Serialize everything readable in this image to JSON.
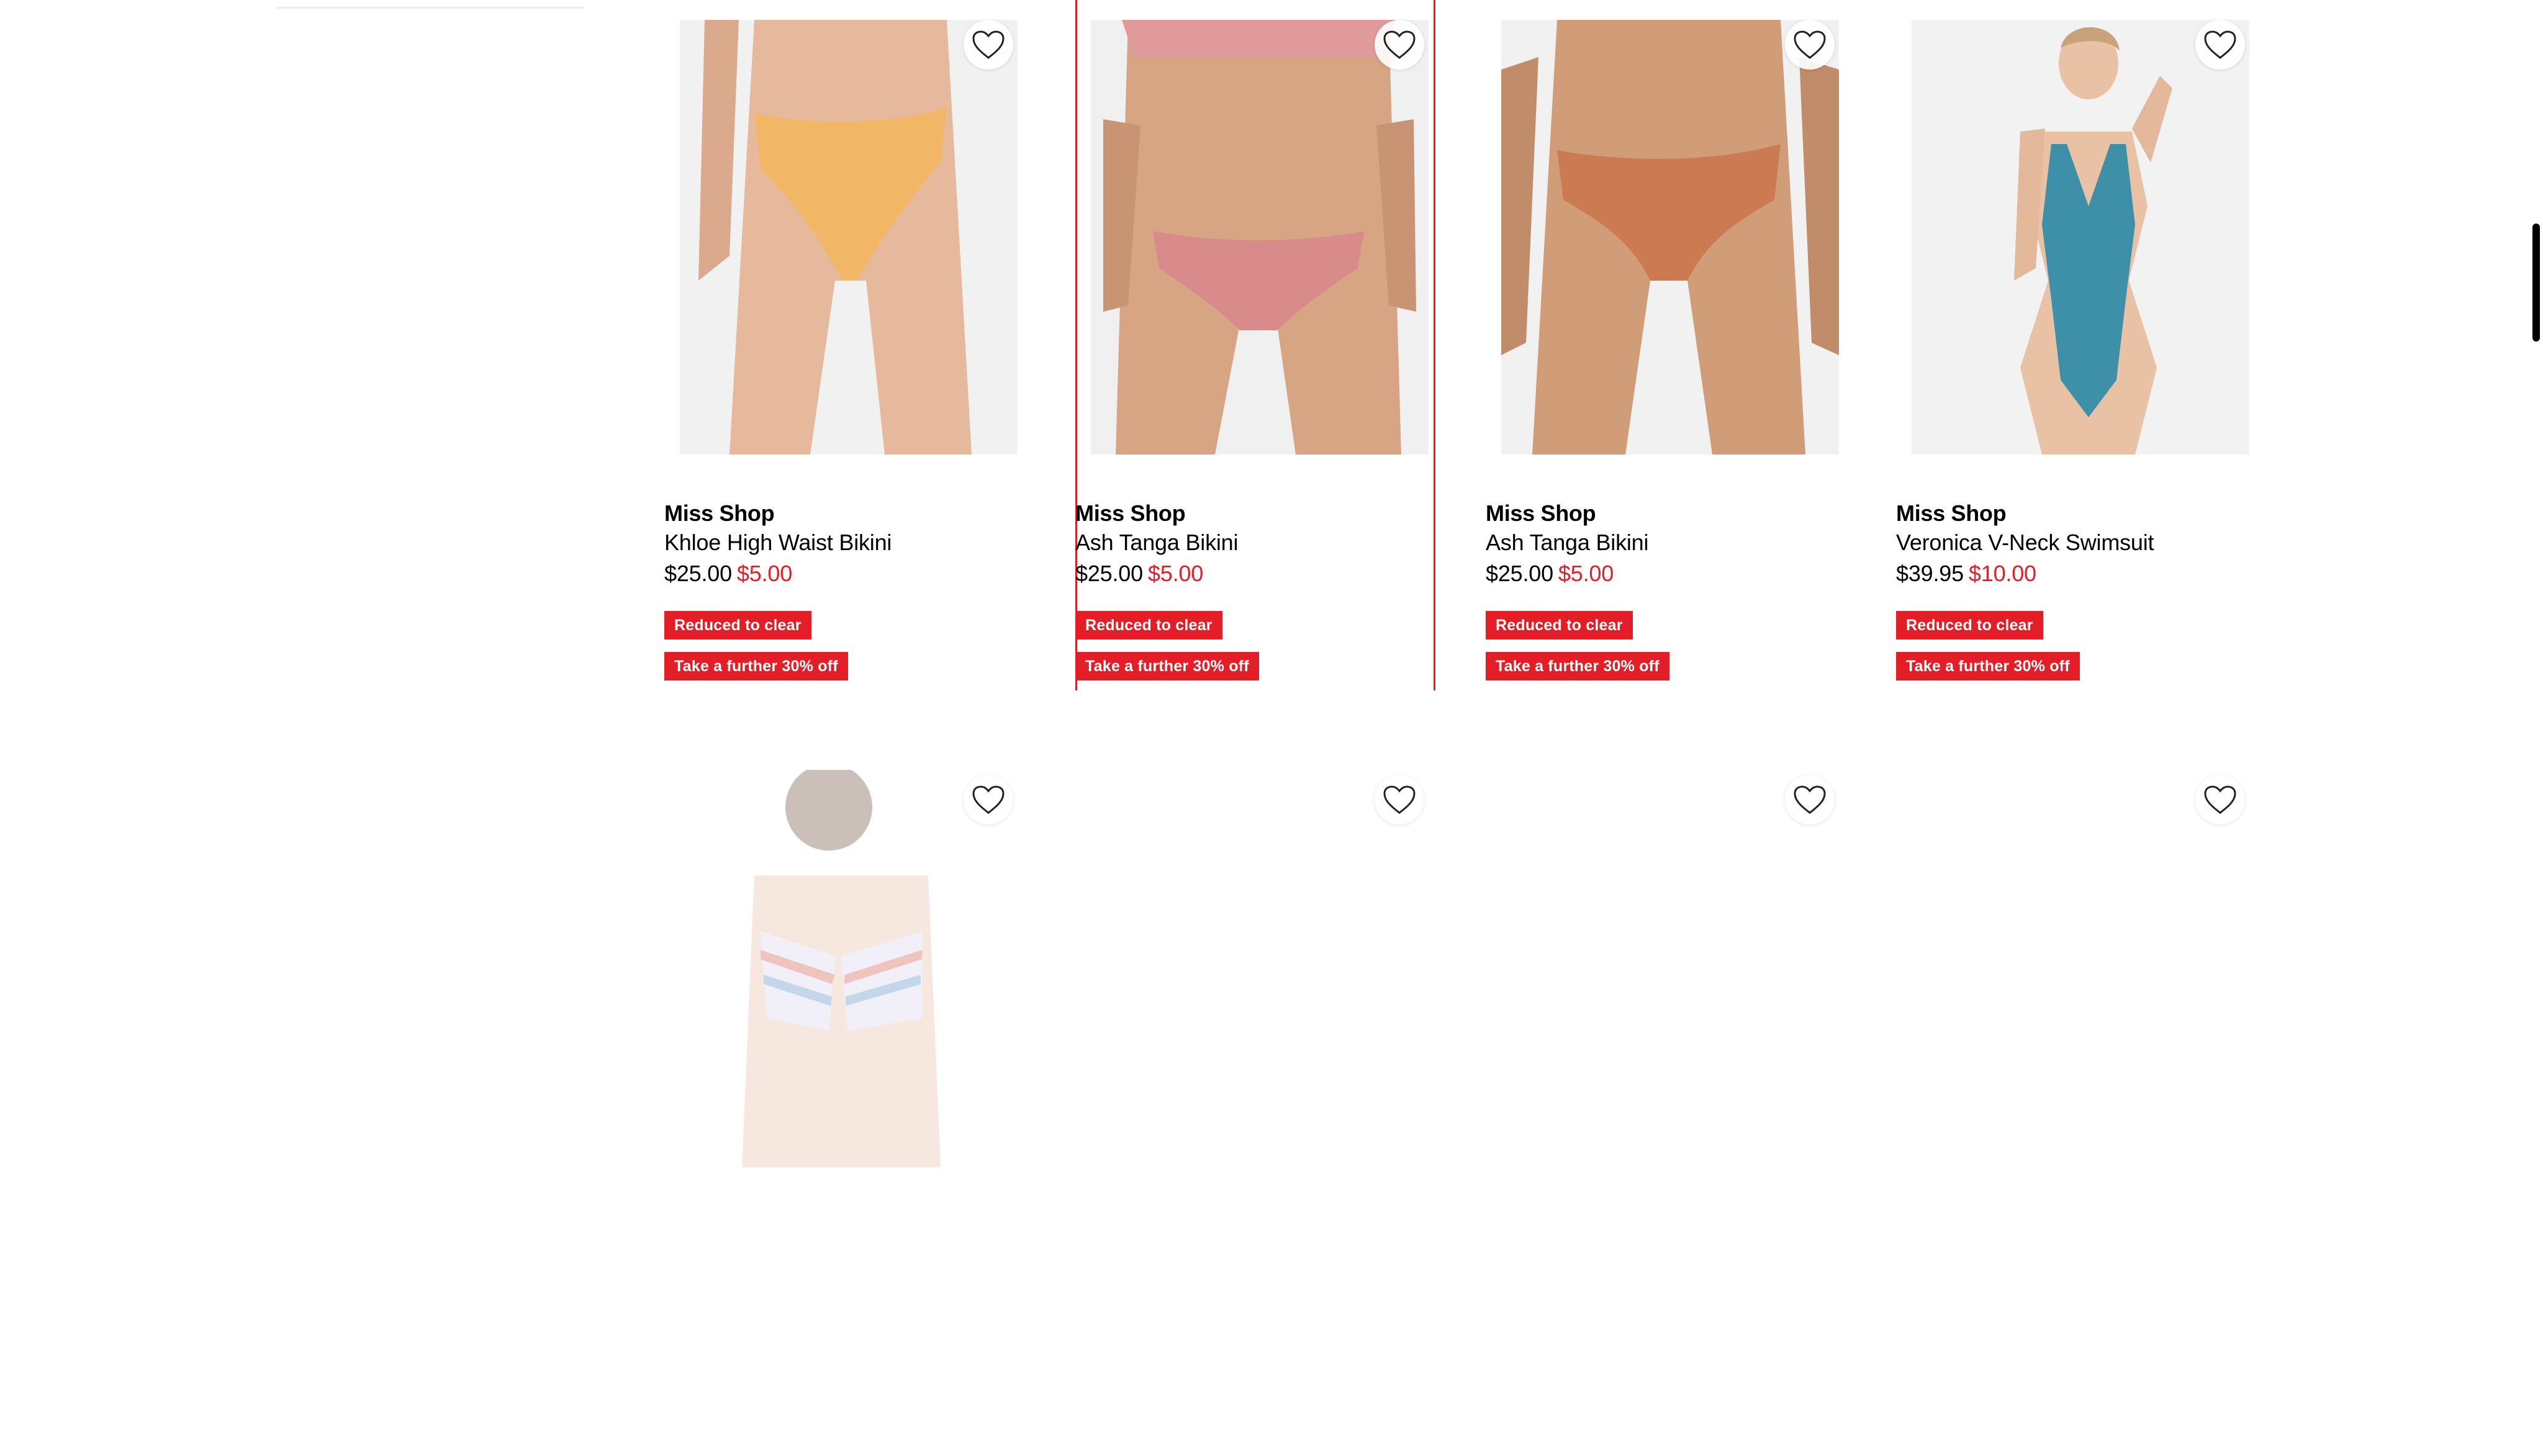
{
  "products_row1": [
    {
      "brand": "Miss Shop",
      "title": "Khloe High Waist Bikini",
      "price_old": "$25.00",
      "price_new": "$5.00",
      "badges": [
        "Reduced to clear",
        "Take a further 30% off"
      ],
      "image": {
        "kind": "bikini-bottom-yellow",
        "garment_color": "#f2b766",
        "skin_color": "#e7b99c"
      }
    },
    {
      "brand": "Miss Shop",
      "title": "Ash Tanga Bikini",
      "price_old": "$25.00",
      "price_new": "$5.00",
      "badges": [
        "Reduced to clear",
        "Take a further 30% off"
      ],
      "image": {
        "kind": "bikini-set-pink",
        "garment_color": "#d98a8a",
        "skin_color": "#d7a584"
      }
    },
    {
      "brand": "Miss Shop",
      "title": "Ash Tanga Bikini",
      "price_old": "$25.00",
      "price_new": "$5.00",
      "badges": [
        "Reduced to clear",
        "Take a further 30% off"
      ],
      "image": {
        "kind": "bikini-bottom-rust",
        "garment_color": "#cc7a52",
        "skin_color": "#d19d79"
      }
    },
    {
      "brand": "Miss Shop",
      "title": "Veronica V-Neck Swimsuit",
      "price_old": "$39.95",
      "price_new": "$10.00",
      "badges": [
        "Reduced to clear",
        "Take a further 30% off"
      ],
      "image": {
        "kind": "swimsuit-teal",
        "garment_color": "#3e8fa8",
        "skin_color": "#e9c2a6"
      }
    }
  ],
  "products_row2": [
    {
      "image": {
        "kind": "bikini-striped-faded"
      }
    },
    {
      "image": {
        "kind": "loading"
      }
    },
    {
      "image": {
        "kind": "loading"
      }
    },
    {
      "image": {
        "kind": "loading"
      }
    }
  ],
  "icons": {
    "favourite": "heart-outline-icon"
  },
  "colors": {
    "sale_red": "#e41e26",
    "hover_outline": "#e41e26"
  }
}
